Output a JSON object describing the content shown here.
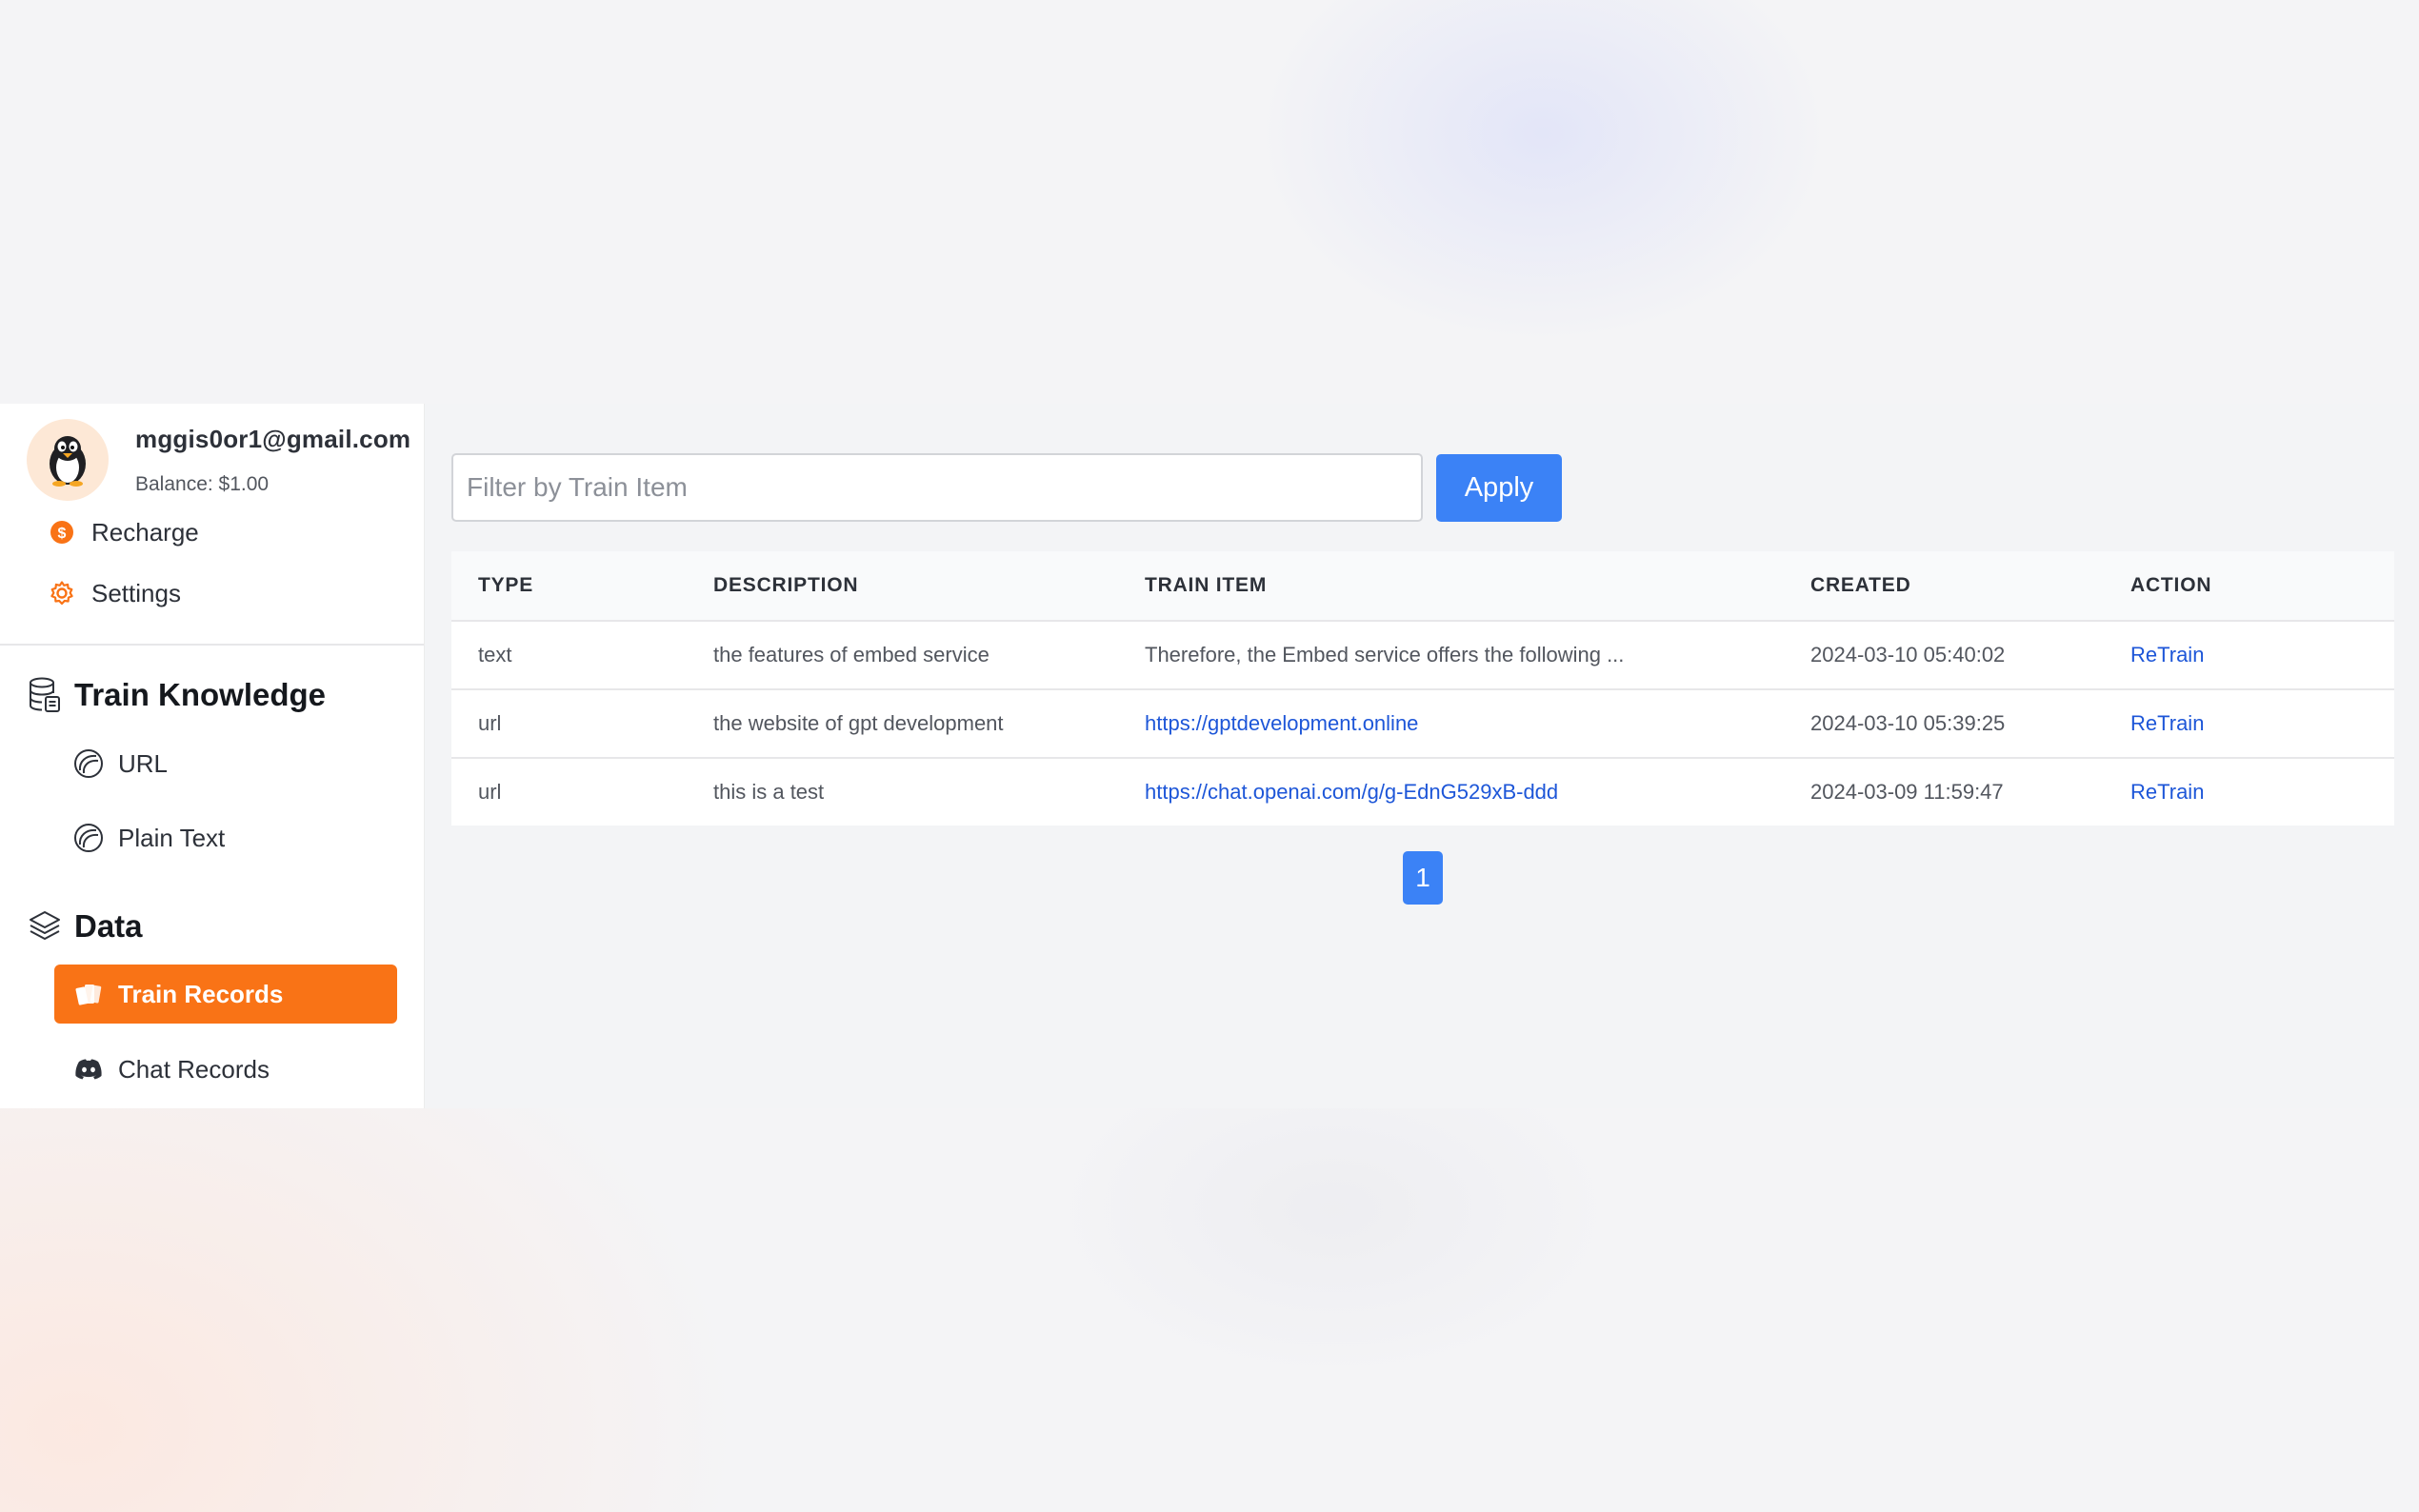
{
  "user": {
    "email": "mggis0or1@gmail.com",
    "balance": "Balance: $1.00",
    "avatar_icon": "penguin-icon"
  },
  "top_menu": {
    "recharge": "Recharge",
    "settings": "Settings"
  },
  "sections": {
    "train_knowledge": {
      "title": "Train Knowledge",
      "items": [
        "URL",
        "Plain Text"
      ]
    },
    "data": {
      "title": "Data",
      "items": [
        "Train Records",
        "Chat Records"
      ],
      "active_item": "Train Records"
    }
  },
  "filter": {
    "placeholder": "Filter by Train Item",
    "value": "",
    "apply_label": "Apply"
  },
  "table": {
    "headers": [
      "TYPE",
      "DESCRIPTION",
      "TRAIN ITEM",
      "CREATED",
      "ACTION"
    ],
    "rows": [
      {
        "type": "text",
        "description": "the features of embed service",
        "train_item": "Therefore, the Embed service offers the following ...",
        "created": "2024-03-10 05:40:02",
        "action": "ReTrain"
      },
      {
        "type": "url",
        "description": "the website of gpt development",
        "train_item": "https://gptdevelopment.online",
        "created": "2024-03-10 05:39:25",
        "action": "ReTrain"
      },
      {
        "type": "url",
        "description": "this is a test",
        "train_item": "https://chat.openai.com/g/g-EdnG529xB-ddd",
        "created": "2024-03-09 11:59:47",
        "action": "ReTrain"
      }
    ]
  },
  "pagination": {
    "current_page": "1"
  },
  "colors": {
    "accent_orange": "#f97316",
    "primary_blue": "#3b82f6",
    "link_blue": "#1d56d8"
  }
}
